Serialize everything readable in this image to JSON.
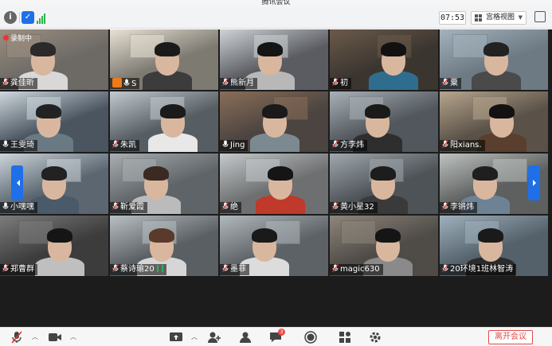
{
  "window": {
    "title": "腾讯会议"
  },
  "toolbar": {
    "timer": "07:53",
    "view_label": "宫格视图",
    "icons": [
      "info-icon",
      "shield-icon",
      "signal-icon",
      "grid-icon",
      "fullscreen-icon"
    ]
  },
  "recording": {
    "label": "录制中"
  },
  "participants": [
    {
      "name": "龚佳昕",
      "muted": true
    },
    {
      "name": "S",
      "muted": false,
      "host": true
    },
    {
      "name": "熊新月",
      "muted": true
    },
    {
      "name": "初",
      "muted": true
    },
    {
      "name": "粟",
      "muted": true
    },
    {
      "name": "王雯琦",
      "muted": false
    },
    {
      "name": "朱凯",
      "muted": true
    },
    {
      "name": "Jing",
      "muted": false
    },
    {
      "name": "方李炜",
      "muted": true
    },
    {
      "name": "阳xians.",
      "muted": true
    },
    {
      "name": "小嘿嘿",
      "muted": false
    },
    {
      "name": "靳爱霞",
      "muted": true
    },
    {
      "name": "绝",
      "muted": true
    },
    {
      "name": "黄小星32",
      "muted": true
    },
    {
      "name": "李锵炜",
      "muted": true
    },
    {
      "name": "郑曹群",
      "muted": true
    },
    {
      "name": "蔡诗瑜20",
      "muted": true,
      "speaking": true
    },
    {
      "name": "墨菲",
      "muted": true
    },
    {
      "name": "magic630",
      "muted": true
    },
    {
      "name": "20环境1班林智涛",
      "muted": true
    }
  ],
  "bottombar": {
    "end_label": "离开会议",
    "chat_badge": "3",
    "icons": [
      "mic-icon",
      "camera-icon",
      "share-screen-icon",
      "invite-icon",
      "members-icon",
      "chat-icon",
      "record-icon",
      "apps-icon",
      "settings-icon"
    ]
  },
  "colors": {
    "accent": "#1f6fe8",
    "end": "#e04b4b",
    "host": "#f07a17"
  }
}
